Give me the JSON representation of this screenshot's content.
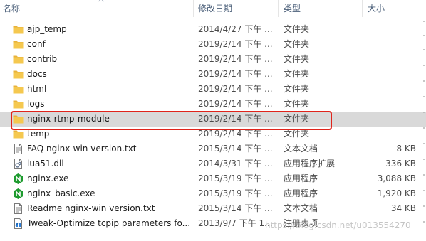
{
  "columns": {
    "name": "名称",
    "date": "修改日期",
    "type": "类型",
    "size": "大小"
  },
  "files": [
    {
      "name": "ajp_temp",
      "date": "2014/4/27 下午 ...",
      "type": "文件夹",
      "size": "",
      "icon": "folder-icon"
    },
    {
      "name": "conf",
      "date": "2019/2/14 下午 ...",
      "type": "文件夹",
      "size": "",
      "icon": "folder-icon"
    },
    {
      "name": "contrib",
      "date": "2019/2/14 下午 ...",
      "type": "文件夹",
      "size": "",
      "icon": "folder-icon"
    },
    {
      "name": "docs",
      "date": "2019/2/14 下午 ...",
      "type": "文件夹",
      "size": "",
      "icon": "folder-icon"
    },
    {
      "name": "html",
      "date": "2019/2/14 下午 ...",
      "type": "文件夹",
      "size": "",
      "icon": "folder-icon"
    },
    {
      "name": "logs",
      "date": "2019/2/14 下午 ...",
      "type": "文件夹",
      "size": "",
      "icon": "folder-icon"
    },
    {
      "name": "nginx-rtmp-module",
      "date": "2019/2/14 下午 ...",
      "type": "文件夹",
      "size": "",
      "icon": "folder-icon",
      "selected": true
    },
    {
      "name": "temp",
      "date": "2019/2/14 下午 ...",
      "type": "文件夹",
      "size": "",
      "icon": "folder-icon"
    },
    {
      "name": "FAQ nginx-win version.txt",
      "date": "2015/3/14 下午 ...",
      "type": "文本文档",
      "size": "8 KB",
      "icon": "text-file-icon"
    },
    {
      "name": "lua51.dll",
      "date": "2014/3/31 下午 ...",
      "type": "应用程序扩展",
      "size": "336 KB",
      "icon": "dll-file-icon"
    },
    {
      "name": "nginx.exe",
      "date": "2015/3/19 下午 ...",
      "type": "应用程序",
      "size": "3,088 KB",
      "icon": "nginx-exe-icon"
    },
    {
      "name": "nginx_basic.exe",
      "date": "2015/3/19 下午 ...",
      "type": "应用程序",
      "size": "1,920 KB",
      "icon": "nginx-exe-icon"
    },
    {
      "name": "Readme nginx-win version.txt",
      "date": "2015/3/14 下午 ...",
      "type": "文本文档",
      "size": "34 KB",
      "icon": "text-file-icon"
    },
    {
      "name": "Tweak-Optimize tcpip parameters fo...",
      "date": "2013/9/7 下午 1...",
      "type": "注册表项",
      "size": "",
      "icon": "registry-file-icon"
    }
  ],
  "watermark": "https://blog.csdn.net/u013554270",
  "colors": {
    "highlight_border": "#e0241b",
    "selected_row": "#d9d9d9",
    "folder": "#f2c24a",
    "nginx_green": "#1e9b2f",
    "header_text": "#4c607a"
  }
}
